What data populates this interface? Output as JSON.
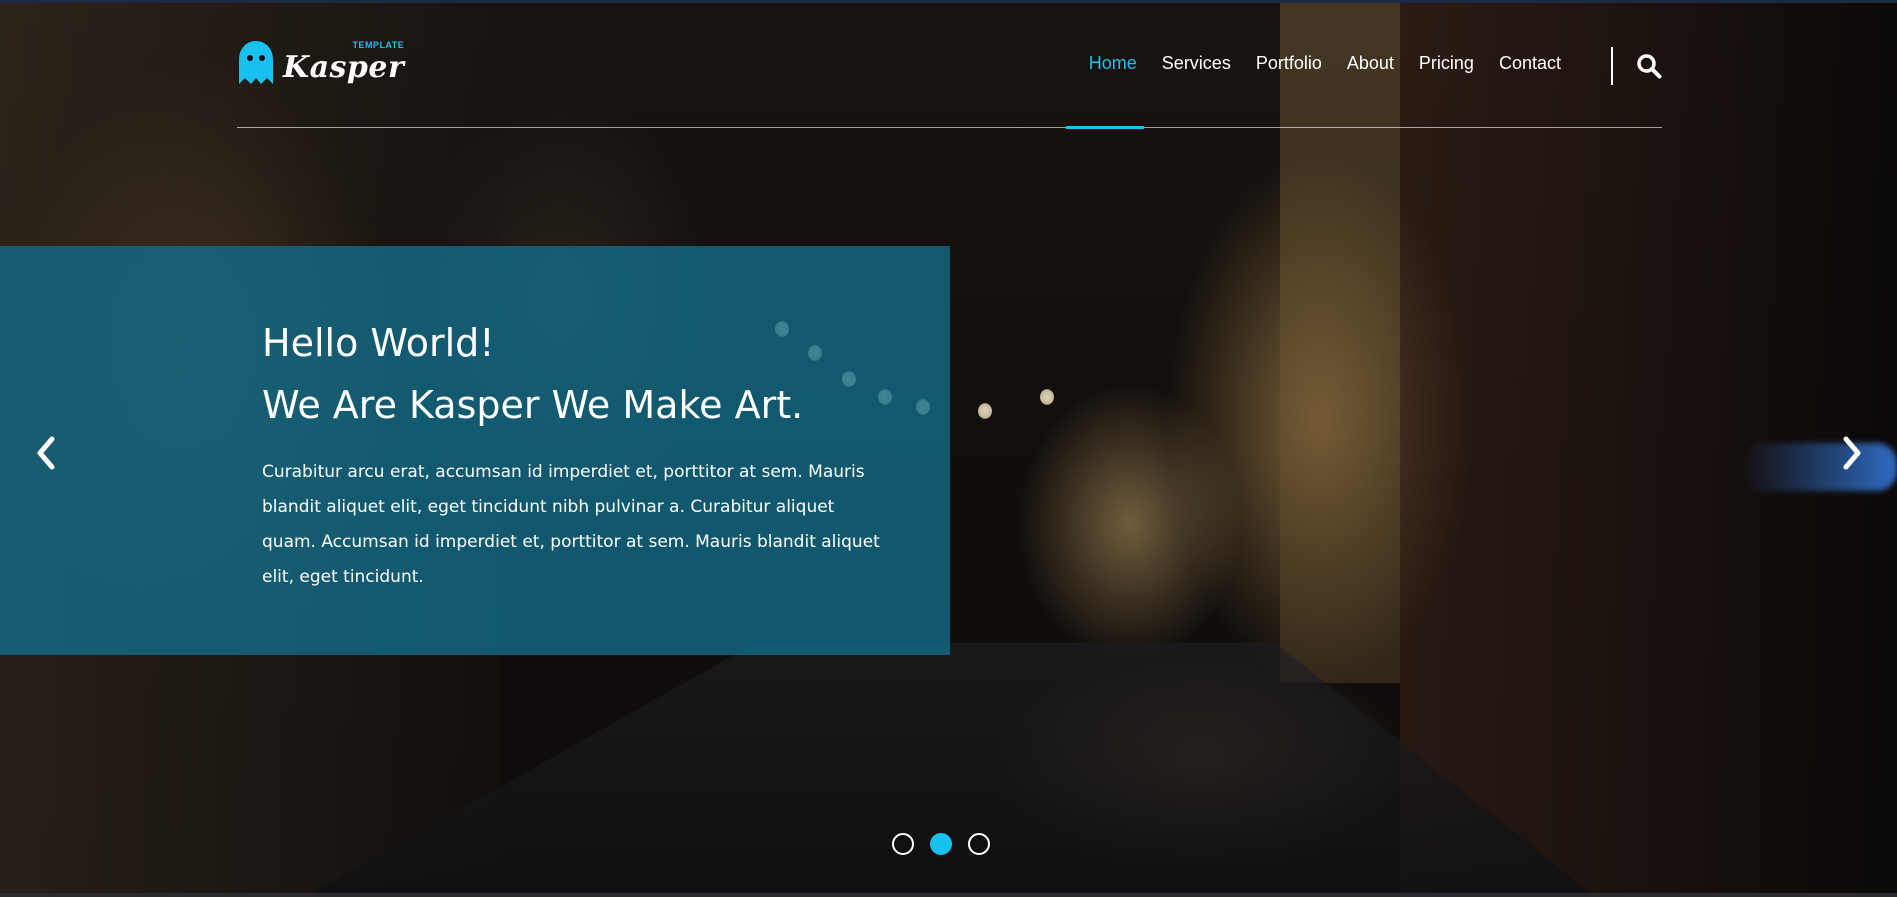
{
  "header": {
    "logo": {
      "word": "Kasper",
      "tag": "TEMPLATE"
    },
    "nav": [
      {
        "label": "Home",
        "active": true
      },
      {
        "label": "Services",
        "active": false
      },
      {
        "label": "Portfolio",
        "active": false
      },
      {
        "label": "About",
        "active": false
      },
      {
        "label": "Pricing",
        "active": false
      },
      {
        "label": "Contact",
        "active": false
      }
    ],
    "search_icon": "search-icon"
  },
  "slide": {
    "title_line1": "Hello World!",
    "title_line2": "We Are Kasper We Make Art.",
    "text": "Curabitur arcu erat, accumsan id imperdiet et, porttitor at sem. Mauris blandit aliquet elit, eget tincidunt nibh pulvinar a. Curabitur aliquet quam. Accumsan id imperdiet et, porttitor at sem. Mauris blandit aliquet elit, eget tincidunt."
  },
  "carousel": {
    "prev_icon": "chevron-left-icon",
    "next_icon": "chevron-right-icon",
    "active_index": 1,
    "count": 3
  },
  "colors": {
    "accent": "#19c1f0",
    "panel": "#126e8c"
  }
}
